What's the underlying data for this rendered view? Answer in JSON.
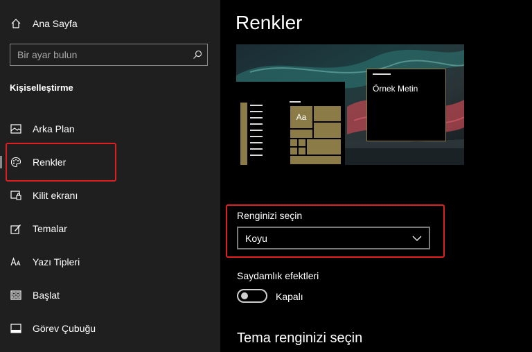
{
  "sidebar": {
    "home_label": "Ana Sayfa",
    "search_placeholder": "Bir ayar bulun",
    "section_title": "Kişiselleştirme",
    "items": [
      {
        "label": "Arka Plan",
        "icon": "picture-icon"
      },
      {
        "label": "Renkler",
        "icon": "palette-icon",
        "selected": true
      },
      {
        "label": "Kilit ekranı",
        "icon": "lock-screen-icon"
      },
      {
        "label": "Temalar",
        "icon": "themes-icon"
      },
      {
        "label": "Yazı Tipleri",
        "icon": "fonts-icon"
      },
      {
        "label": "Başlat",
        "icon": "start-icon"
      },
      {
        "label": "Görev Çubuğu",
        "icon": "taskbar-icon"
      }
    ]
  },
  "main": {
    "title": "Renkler",
    "preview": {
      "sample_text": "Örnek Metin",
      "tile_text": "Aa",
      "accent_color": "#8b7b46"
    },
    "color_mode": {
      "label": "Renginizi seçin",
      "value": "Koyu"
    },
    "transparency": {
      "label": "Saydamlık efektleri",
      "state": "Kapalı",
      "on": false
    },
    "accent_heading": "Tema renginizi seçin"
  },
  "highlight_color": "#e02020"
}
